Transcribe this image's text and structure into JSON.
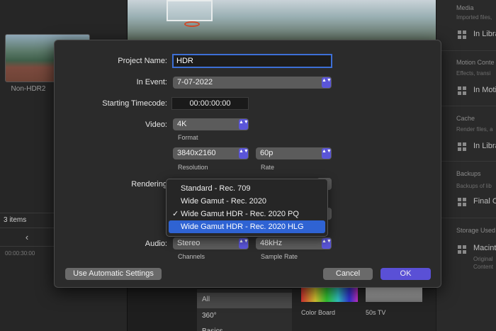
{
  "library": {
    "clip_label": "Non-HDR2",
    "items_count": "3 items",
    "back_glyph": "‹",
    "timecode": "00:00:30:00"
  },
  "inspector": {
    "sections": [
      {
        "title": "Media",
        "sub": "Imported files,",
        "row": "In Libra"
      },
      {
        "title": "Motion Conte",
        "sub": "Effects, transi",
        "row": "In Motio"
      },
      {
        "title": "Cache",
        "sub": "Render files, a",
        "row": "In Libra"
      },
      {
        "title": "Backups",
        "sub": "Backups of lib",
        "row": "Final C"
      },
      {
        "title": "Storage Used",
        "sub": "",
        "row": "Macinto",
        "extra1": "Original",
        "extra2": "Content"
      }
    ]
  },
  "browser": {
    "categories": [
      "All",
      "360°",
      "Basics"
    ],
    "tiles": [
      {
        "label": "Color Board"
      },
      {
        "label": "50s TV"
      }
    ]
  },
  "dialog": {
    "project_name_label": "Project Name:",
    "project_name_value": "HDR",
    "in_event_label": "In Event:",
    "in_event_value": "7-07-2022",
    "starting_timecode_label": "Starting Timecode:",
    "starting_timecode_value": "00:00:00:00",
    "video_label": "Video:",
    "format_value": "4K",
    "format_caption": "Format",
    "resolution_value": "3840x2160",
    "resolution_caption": "Resolution",
    "rate_value": "60p",
    "rate_caption": "Rate",
    "rendering_label": "Rendering",
    "audio_label": "Audio:",
    "channels_value": "Stereo",
    "channels_caption": "Channels",
    "sample_rate_value": "48kHz",
    "sample_rate_caption": "Sample Rate",
    "auto_settings_button": "Use Automatic Settings",
    "cancel_button": "Cancel",
    "ok_button": "OK",
    "popup_arrow_glyph": "▲▼"
  },
  "color_space_menu": {
    "items": [
      {
        "label": "Standard - Rec. 709",
        "checked": false,
        "highlighted": false
      },
      {
        "label": "Wide Gamut - Rec. 2020",
        "checked": false,
        "highlighted": false
      },
      {
        "label": "Wide Gamut HDR - Rec. 2020 PQ",
        "checked": true,
        "highlighted": false
      },
      {
        "label": "Wide Gamut HDR - Rec. 2020 HLG",
        "checked": false,
        "highlighted": true
      }
    ],
    "check_glyph": "✓"
  },
  "colors": {
    "accent": "#5a50d6",
    "menu_highlight": "#2f63d3",
    "focus_ring": "#3d6fd6"
  }
}
